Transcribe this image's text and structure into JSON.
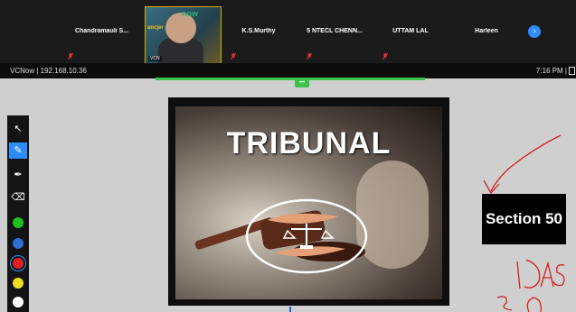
{
  "participants": [
    {
      "name": "Chandramauli  S..."
    },
    {
      "name": "K.S.Murthy"
    },
    {
      "name": "5  NTECL  CHENN..."
    },
    {
      "name": "UTTAM LAL"
    },
    {
      "name": "Harleen"
    }
  ],
  "video_tile": {
    "logo": "now",
    "badge": "ancjer",
    "label": "VCN"
  },
  "next_button_icon": "chevron-right-icon",
  "topbar": {
    "app_title": "VCNow  |  192.168.10.36",
    "clock": "7:16 PM  |"
  },
  "share_handle": "•••",
  "toolbar": {
    "tools": [
      {
        "icon": "expand-arrow-icon",
        "glyph": "↖"
      },
      {
        "icon": "pen-icon",
        "glyph": "✎"
      },
      {
        "icon": "marker-icon",
        "glyph": "✒"
      },
      {
        "icon": "eraser-icon",
        "glyph": "⌫"
      }
    ],
    "colors": [
      "#1ec11e",
      "#2d6fd6",
      "#e02020",
      "#f0e020",
      "#ffffff"
    ],
    "selected_color": "#e02020"
  },
  "slide": {
    "title": "TRIBUNAL"
  },
  "annotation": {
    "section_label": "Section 50",
    "handwriting": "IDAS"
  }
}
